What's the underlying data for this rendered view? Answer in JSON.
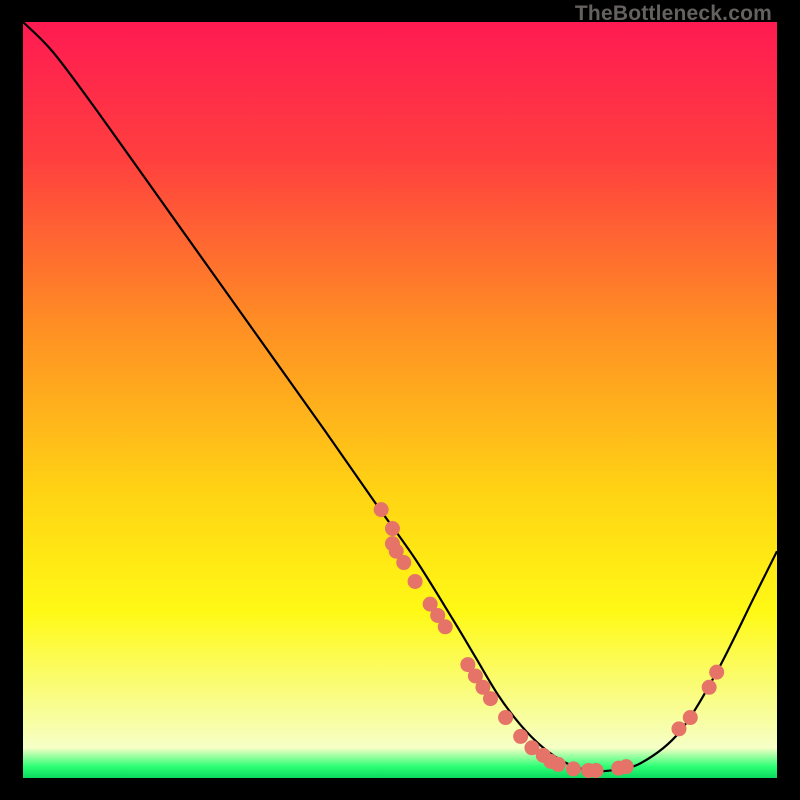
{
  "watermark": "TheBottleneck.com",
  "chart_data": {
    "type": "line",
    "title": "",
    "xlabel": "",
    "ylabel": "",
    "xlim": [
      0,
      100
    ],
    "ylim": [
      0,
      100
    ],
    "background_gradient": {
      "stops": [
        {
          "offset": 0.0,
          "color": "#ff1a52"
        },
        {
          "offset": 0.18,
          "color": "#ff3f3f"
        },
        {
          "offset": 0.4,
          "color": "#ff8e24"
        },
        {
          "offset": 0.62,
          "color": "#ffd314"
        },
        {
          "offset": 0.78,
          "color": "#fff915"
        },
        {
          "offset": 0.96,
          "color": "#f6ffc6"
        },
        {
          "offset": 0.985,
          "color": "#2bff74"
        },
        {
          "offset": 1.0,
          "color": "#0bd95e"
        }
      ]
    },
    "series": [
      {
        "name": "bottleneck-curve",
        "x": [
          0,
          4,
          10,
          20,
          30,
          40,
          47,
          52,
          57,
          60,
          63,
          66,
          69,
          72,
          75,
          78,
          82,
          87,
          92,
          97,
          100
        ],
        "y": [
          100,
          96,
          88,
          74,
          60,
          46,
          36,
          29,
          21,
          16,
          11,
          7,
          4,
          2,
          1,
          1,
          2,
          6,
          14,
          24,
          30
        ]
      }
    ],
    "scatter_points": {
      "name": "marked-points",
      "color": "#e57368",
      "points": [
        {
          "x": 47.5,
          "y": 35.5
        },
        {
          "x": 49.0,
          "y": 33.0
        },
        {
          "x": 49.0,
          "y": 31.0
        },
        {
          "x": 49.5,
          "y": 30.0
        },
        {
          "x": 50.5,
          "y": 28.5
        },
        {
          "x": 52.0,
          "y": 26.0
        },
        {
          "x": 54.0,
          "y": 23.0
        },
        {
          "x": 55.0,
          "y": 21.5
        },
        {
          "x": 56.0,
          "y": 20.0
        },
        {
          "x": 59.0,
          "y": 15.0
        },
        {
          "x": 60.0,
          "y": 13.5
        },
        {
          "x": 61.0,
          "y": 12.0
        },
        {
          "x": 62.0,
          "y": 10.5
        },
        {
          "x": 64.0,
          "y": 8.0
        },
        {
          "x": 66.0,
          "y": 5.5
        },
        {
          "x": 67.5,
          "y": 4.0
        },
        {
          "x": 69.0,
          "y": 3.0
        },
        {
          "x": 70.0,
          "y": 2.2
        },
        {
          "x": 71.0,
          "y": 1.8
        },
        {
          "x": 73.0,
          "y": 1.2
        },
        {
          "x": 75.0,
          "y": 1.0
        },
        {
          "x": 76.0,
          "y": 1.0
        },
        {
          "x": 79.0,
          "y": 1.3
        },
        {
          "x": 80.0,
          "y": 1.5
        },
        {
          "x": 87.0,
          "y": 6.5
        },
        {
          "x": 88.5,
          "y": 8.0
        },
        {
          "x": 91.0,
          "y": 12.0
        },
        {
          "x": 92.0,
          "y": 14.0
        }
      ]
    }
  }
}
